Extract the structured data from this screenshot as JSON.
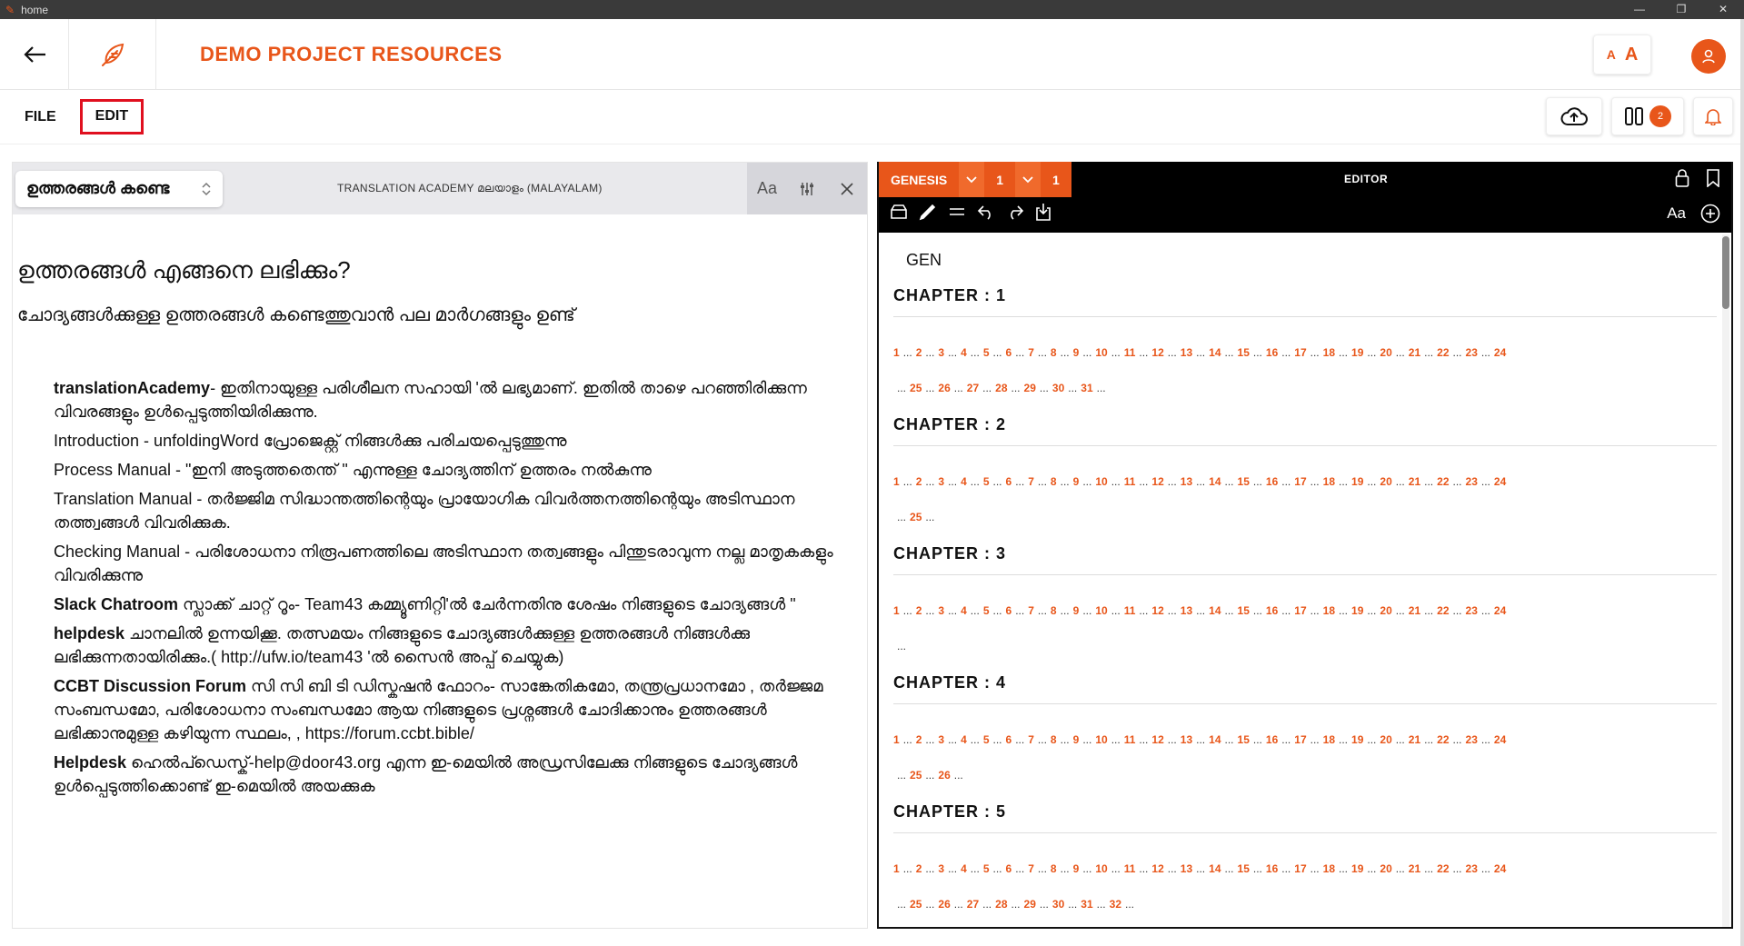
{
  "window": {
    "title": "home",
    "controls": [
      "—",
      "❐",
      "✕"
    ]
  },
  "appbar": {
    "project_title": "DEMO PROJECT RESOURCES",
    "font_small": "A",
    "font_big": "A"
  },
  "menu": {
    "file": "FILE",
    "edit": "EDIT"
  },
  "badges": {
    "notifications_count": "2"
  },
  "left_pane": {
    "select_value": "ഉത്തരങ്ങൾ കണ്ടെ",
    "title": "TRANSLATION ACADEMY മലയാളം (MALAYALAM)",
    "tools": {
      "font": "Aa"
    },
    "heading": "ഉത്തരങ്ങൾ എങ്ങനെ ലഭിക്കും?",
    "intro": "ചോദ്യങ്ങൾക്കുള്ള ഉത്തരങ്ങൾ കണ്ടെത്തുവാൻ പല മാർഗങ്ങളും ഉണ്ട്",
    "items": [
      {
        "bold": "translationAcademy",
        "text": "- ഇതിനായുള്ള പരിശീലന സഹായി 'ൽ ലഭ്യമാണ്. ഇതിൽ താഴെ പറഞ്ഞിരിക്കുന്ന വിവരങ്ങളും ഉൾപ്പെടുത്തിയിരിക്കുന്നു."
      },
      {
        "bold": "",
        "text": "Introduction - unfoldingWord പ്രോജെക്റ്റ് നിങ്ങൾക്കു പരിചയപ്പെടുത്തുന്നു"
      },
      {
        "bold": "",
        "text": "Process Manual - \"ഇനി അടുത്തതെന്ത് \" എന്നുള്ള ചോദ്യത്തിന് ഉത്തരം നൽകുന്നു"
      },
      {
        "bold": "",
        "text": "Translation Manual - തർജ്ജിമ സിദ്ധാന്തത്തിന്റെയും പ്രായോഗിക വിവർത്തനത്തിന്റെയും അടിസ്ഥാന തത്ത്വങ്ങൾ വിവരിക്കുക."
      },
      {
        "bold": "",
        "text": "Checking Manual - പരിശോധനാ നിരൂപണത്തിലെ അടിസ്ഥാന തത്വങ്ങളും പിന്തുടരാവുന്ന നല്ല മാതൃകകളും വിവരിക്കുന്നു"
      },
      {
        "bold": "Slack Chatroom",
        "text": " സ്ലാക്ക് ചാറ്റ് റൂം- Team43 കമ്മ്യൂണിറ്റി'ൽ ചേർന്നതിനു ശേഷം നിങ്ങളുടെ ചോദ്യങ്ങൾ \""
      },
      {
        "bold": "helpdesk",
        "text": " ചാനലിൽ ഉന്നയിക്കൂ. തത്സമയം നിങ്ങളുടെ ചോദ്യങ്ങൾക്കുള്ള ഉത്തരങ്ങൾ നിങ്ങൾക്കു ലഭിക്കുന്നതായിരിക്കും.( http://ufw.io/team43 'ൽ സൈൻ അപ്പ് ചെയ്യുക)"
      },
      {
        "bold": "CCBT Discussion Forum",
        "text": " സി സി ബി ടി ഡിസ്കഷൻ ഫോറം- സാങ്കേതികമോ, തന്ത്രപ്രധാനമോ , തർജ്ജമ സംബന്ധമോ, പരിശോധനാ സംബന്ധമോ ആയ നിങ്ങളുടെ പ്രശ്നങ്ങൾ ചോദിക്കാനും ഉത്തരങ്ങൾ ലഭിക്കാനുമുള്ള കഴിയുന്ന സ്ഥലം, , https://forum.ccbt.bible/"
      },
      {
        "bold": "Helpdesk",
        "text": " ഹെൽപ്ഡെസ്ക്-help@door43.org എന്ന ഇ-മെയിൽ അഡ്രസിലേക്കു നിങ്ങളുടെ ചോദ്യങ്ങൾ ഉൾപ്പെടുത്തിക്കൊണ്ട് ഇ-മെയിൽ അയക്കുക"
      }
    ]
  },
  "editor": {
    "book": "GENESIS",
    "chapter": "1",
    "verse": "1",
    "label": "EDITOR",
    "font_btn": "Aa",
    "book_code": "GEN",
    "chapters": [
      {
        "title": "CHAPTER : 1",
        "verse_count": 31
      },
      {
        "title": "CHAPTER : 2",
        "verse_count": 25
      },
      {
        "title": "CHAPTER : 3",
        "verse_count": 24
      },
      {
        "title": "CHAPTER : 4",
        "verse_count": 26
      },
      {
        "title": "CHAPTER : 5",
        "verse_count": 32
      }
    ]
  },
  "colors": {
    "accent": "#e8561a",
    "highlight_border": "#e0101f"
  }
}
